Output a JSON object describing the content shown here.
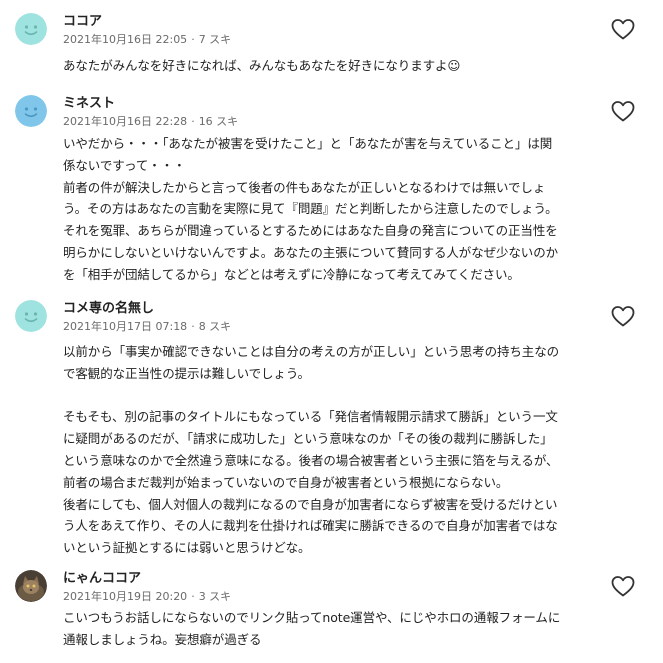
{
  "comments": [
    {
      "name": "ココア",
      "date": "2021年10月16日 22:05",
      "likes": "7 スキ",
      "avatar_icon": "smiley-face-icon",
      "avatar_color": "#9ee3df",
      "lines": [
        "あなたがみんなを好きになれば、みんなもあなたを好きになりますよ☺"
      ]
    },
    {
      "name": "ミネスト",
      "date": "2021年10月16日 22:28",
      "likes": "16 スキ",
      "avatar_icon": "smiley-face-icon",
      "avatar_color": "#7fc6ea",
      "lines": [
        "いやだから・・・「あなたが被害を受けたこと」と「あなたが害を与えていること」は関",
        "係ないですって・・・",
        "前者の件が解決したからと言って後者の件もあなたが正しいとなるわけでは無いでしょ",
        "う。その方はあなたの言動を実際に見て『問題』だと判断したから注意したのでしょう。",
        "それを冤罪、あちらが間違っているとするためにはあなた自身の発言についての正当性を",
        "明らかにしないといけないんですよ。あなたの主張について賛同する人がなぜ少ないのか",
        "を「相手が団結してるから」などとは考えずに冷静になって考えてみてください。"
      ]
    },
    {
      "name": "コメ専の名無し",
      "date": "2021年10月17日 07:18",
      "likes": "8 スキ",
      "avatar_icon": "smiley-face-icon",
      "avatar_color": "#9ee3df",
      "lines": [
        "以前から「事実か確認できないことは自分の考えの方が正しい」という思考の持ち主なの",
        "で客観的な正当性の提示は難しいでしょう。",
        "",
        "そもそも、別の記事のタイトルにもなっている「発信者情報開示請求て勝訴」という一文",
        "に疑問があるのだが、「請求に成功した」という意味なのか「その後の裁判に勝訴した」",
        "という意味なのかで全然違う意味になる。後者の場合被害者という主張に箔を与えるが、",
        "前者の場合まだ裁判が始まっていないので自身が被害者という根拠にならない。",
        "後者にしても、個人対個人の裁判になるので自身が加害者にならず被害を受けるだけとい",
        "う人をあえて作り、その人に裁判を仕掛ければ確実に勝訴できるので自身が加害者ではな",
        "いという証拠とするには弱いと思うけどな。"
      ]
    },
    {
      "name": "にゃんココア",
      "date": "2021年10月19日 20:20",
      "likes": "3 スキ",
      "avatar_icon": "cat-photo-icon",
      "avatar_color": "#4a3f35",
      "lines": [
        "こいつもうお話しにならないのでリンク貼ってnote運営や、にじやホロの通報フォームに",
        "通報しましょうね。妄想癖が過ぎる"
      ]
    }
  ]
}
